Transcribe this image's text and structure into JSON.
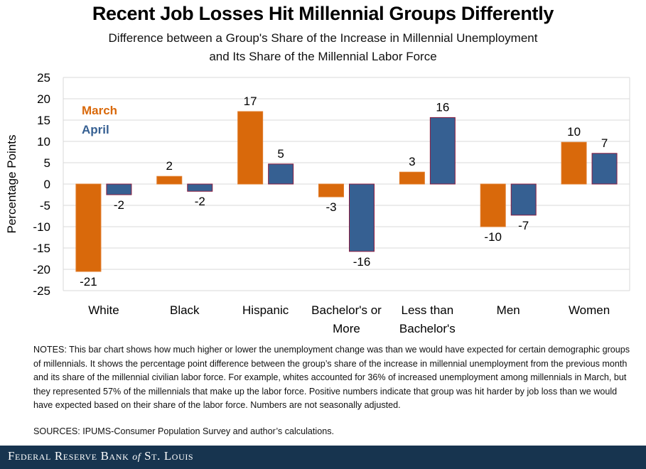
{
  "header": {
    "title": "Recent Job Losses Hit Millennial Groups Differently",
    "subtitle_line1": "Difference between a Group's Share of the Increase in Millennial Unemployment",
    "subtitle_line2": "and Its Share of the Millennial Labor Force"
  },
  "chart_data": {
    "type": "bar",
    "title": "Recent Job Losses Hit Millennial Groups Differently",
    "subtitle": "Difference between a Group's Share of the Increase in Millennial Unemployment and Its Share of the Millennial Labor Force",
    "xlabel": "",
    "ylabel": "Percentage Points",
    "ylim": [
      -25,
      25
    ],
    "yticks": [
      25,
      20,
      15,
      10,
      5,
      0,
      -5,
      -10,
      -15,
      -20,
      -25
    ],
    "grid": true,
    "legend_position": "top-left",
    "categories": [
      [
        "White"
      ],
      [
        "Black"
      ],
      [
        "Hispanic"
      ],
      [
        "Bachelor's or",
        "More"
      ],
      [
        "Less than",
        "Bachelor's"
      ],
      [
        "Men"
      ],
      [
        "Women"
      ]
    ],
    "series": [
      {
        "name": "March",
        "color": "#d9690b",
        "values": [
          -20.5,
          1.8,
          17.0,
          -3.0,
          2.8,
          -10.0,
          9.8
        ],
        "labels": [
          "-21",
          "2",
          "17",
          "-3",
          "3",
          "-10",
          "10"
        ]
      },
      {
        "name": "April",
        "color": "#366092",
        "border_color": "#8b1c3f",
        "values": [
          -2.5,
          -1.7,
          4.7,
          -15.8,
          15.6,
          -7.3,
          7.2
        ],
        "labels": [
          "-2",
          "-2",
          "5",
          "-16",
          "16",
          "-7",
          "7"
        ]
      }
    ]
  },
  "notes": "NOTES: This bar chart shows how much higher or lower the unemployment  change was than we would have expected for certain demographic groups of millennials. It shows the percentage point difference between the group’s share of the increase in millennial unemployment  from the previous month and its share of the millennial civilian labor force. For example, whites accounted for 36% of increased unemployment  among millennials in March, but they represented 57% of the millennials that make up the labor force. Positive numbers  indicate that group was hit harder by job loss than we would have expected based on their share of the labor force.  Numbers are not seasonally adjusted.",
  "sources": "SOURCES: IPUMS-Consumer  Population Survey and author’s calculations.",
  "footer": {
    "part1": "Federal Reserve Bank ",
    "part2": "of",
    "part3": " St. Louis",
    "background": "#17344f"
  }
}
